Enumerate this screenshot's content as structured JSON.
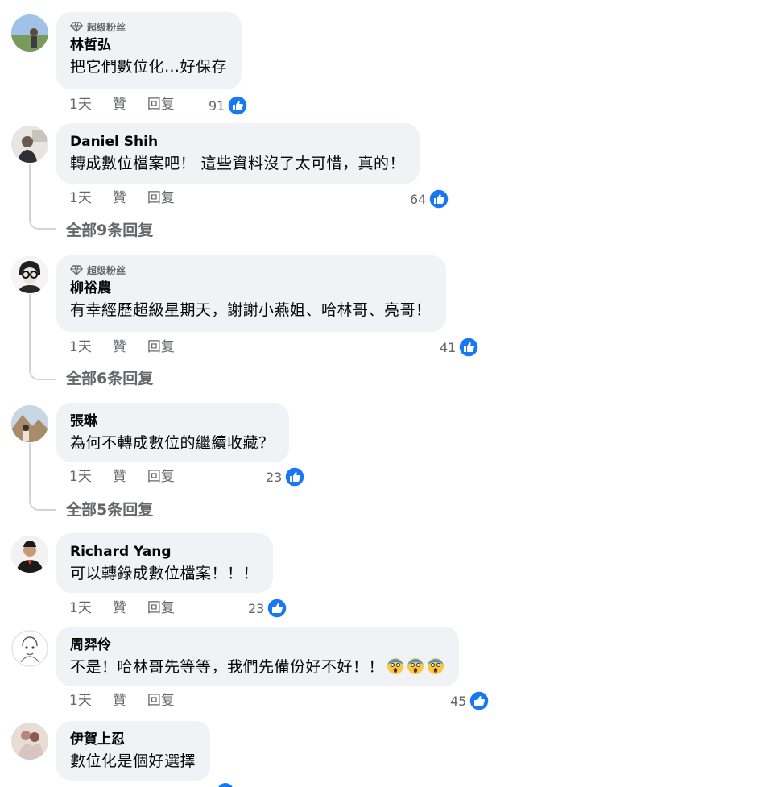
{
  "comments": [
    {
      "author": "林哲弘",
      "badge": "超级粉丝",
      "text": "把它們數位化…好保存",
      "time": "1天",
      "like_label": "贊",
      "reply_label": "回复",
      "reactions": "91",
      "view_replies": ""
    },
    {
      "author": "Daniel Shih",
      "badge": "",
      "text": "轉成數位檔案吧！ 這些資料沒了太可惜，真的！",
      "time": "1天",
      "like_label": "贊",
      "reply_label": "回复",
      "reactions": "64",
      "view_replies": "全部9条回复"
    },
    {
      "author": "柳裕農",
      "badge": "超级粉丝",
      "text": "有幸經歷超級星期天，謝謝小燕姐、哈林哥、亮哥！",
      "time": "1天",
      "like_label": "贊",
      "reply_label": "回复",
      "reactions": "41",
      "view_replies": "全部6条回复"
    },
    {
      "author": "張琳",
      "badge": "",
      "text": "為何不轉成數位的繼續收藏？",
      "time": "1天",
      "like_label": "贊",
      "reply_label": "回复",
      "reactions": "23",
      "view_replies": "全部5条回复"
    },
    {
      "author": "Richard Yang",
      "badge": "",
      "text": "可以轉錄成數位檔案！！！",
      "time": "1天",
      "like_label": "贊",
      "reply_label": "回复",
      "reactions": "23",
      "view_replies": ""
    },
    {
      "author": "周羿伶",
      "badge": "",
      "text": "不是！哈林哥先等等，我們先備份好不好！！",
      "time": "1天",
      "like_label": "贊",
      "reply_label": "回复",
      "reactions": "45",
      "view_replies": ""
    },
    {
      "author": "伊賀上忍",
      "badge": "",
      "text": "數位化是個好選擇",
      "time": "",
      "like_label": "",
      "reply_label": "",
      "reactions": "",
      "view_replies": ""
    }
  ],
  "icons": {
    "badge": "diamond-icon",
    "reaction": "thumbs-up-icon",
    "emoji": "screaming-face-emoji"
  },
  "colors": {
    "bubble": "#f0f2f5",
    "like_blue": "#1877f2",
    "secondary_text": "#65676b"
  }
}
